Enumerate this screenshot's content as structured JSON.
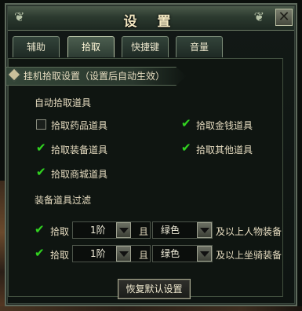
{
  "window": {
    "title": "设 置",
    "close_glyph": "✕"
  },
  "tabs": [
    {
      "label": "辅助",
      "active": false
    },
    {
      "label": "拾取",
      "active": true
    },
    {
      "label": "快捷键",
      "active": false
    },
    {
      "label": "音量",
      "active": false
    }
  ],
  "section": {
    "title": "挂机拾取设置（设置后自动生效）"
  },
  "auto_pickup": {
    "label": "自动拾取道具",
    "options": [
      {
        "label": "拾取药品道具",
        "checked": false
      },
      {
        "label": "拾取金钱道具",
        "checked": true
      },
      {
        "label": "拾取装备道具",
        "checked": true
      },
      {
        "label": "拾取其他道具",
        "checked": true
      },
      {
        "label": "拾取商城道具",
        "checked": true
      }
    ]
  },
  "equip_filter": {
    "label": "装备道具过滤",
    "rows": [
      {
        "checked": true,
        "prefix": "拾取",
        "level": "1阶",
        "conj": "且",
        "color": "绿色",
        "suffix": "及以上人物装备"
      },
      {
        "checked": true,
        "prefix": "拾取",
        "level": "1阶",
        "conj": "且",
        "color": "绿色",
        "suffix": "及以上坐骑装备"
      }
    ]
  },
  "buttons": {
    "reset": "恢复默认设置"
  },
  "colors": {
    "check": "#35d21d",
    "text": "#e6dcc0",
    "title": "#f2e7c1"
  }
}
